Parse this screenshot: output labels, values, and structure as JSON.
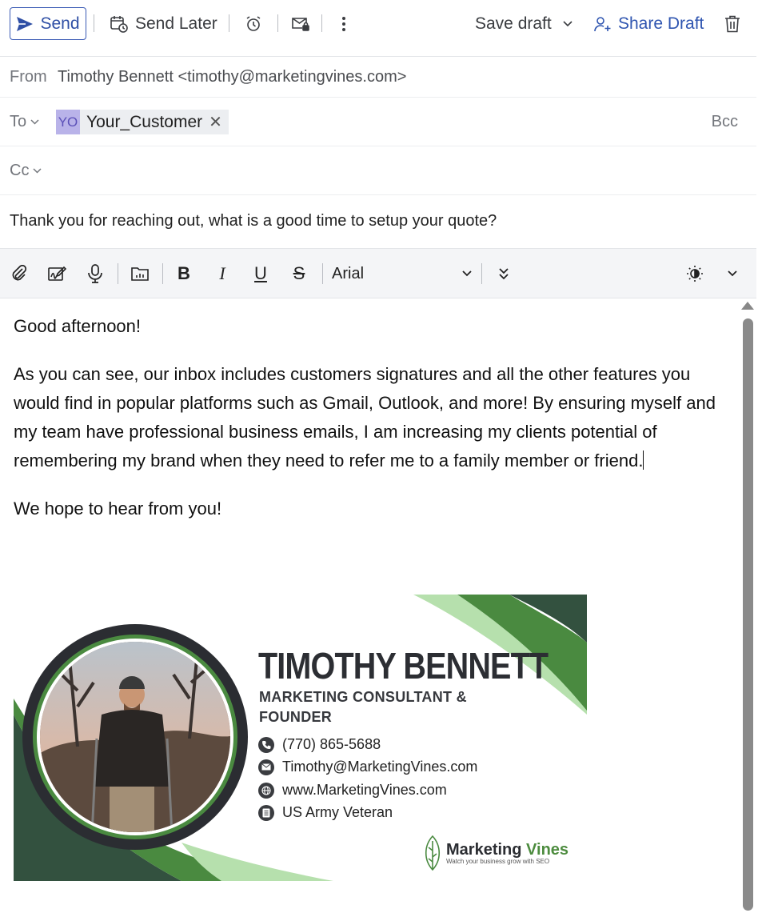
{
  "toolbar": {
    "send": "Send",
    "send_later": "Send Later",
    "save_draft": "Save draft",
    "share_draft": "Share Draft"
  },
  "header": {
    "from_label": "From",
    "from_value": "Timothy Bennett <timothy@marketingvines.com>",
    "to_label": "To",
    "to_chip_initials": "YO",
    "to_chip_name": "Your_Customer",
    "bcc_label": "Bcc",
    "cc_label": "Cc",
    "subject": "Thank you for reaching out, what is a good time to setup your quote?"
  },
  "format": {
    "font": "Arial",
    "bold": "B",
    "italic": "I",
    "underline": "U",
    "strike": "S"
  },
  "body": {
    "greeting": "Good afternoon!",
    "paragraph": "As you can see, our inbox includes customers signatures and all the other features you would find in popular platforms such as Gmail, Outlook, and more! By ensuring myself and my team have professional business emails, I am increasing my clients potential of remembering my brand when they need to refer me to a family member or friend.",
    "closing": "We hope to hear from you!"
  },
  "signature": {
    "name": "TIMOTHY BENNETT",
    "role": "MARKETING CONSULTANT & FOUNDER",
    "phone": "(770) 865-5688",
    "email": "Timothy@MarketingVines.com",
    "website": "www.MarketingVines.com",
    "note": "US Army Veteran",
    "brand_first": "Marketing ",
    "brand_second": "Vines",
    "brand_tagline": "Watch your business grow with SEO",
    "colors": {
      "dark_green": "#33513f",
      "green": "#4a8a40",
      "light_green": "#b6e0ad",
      "ring": "#2b2d32"
    }
  },
  "colors": {
    "accent": "#2f4fa5",
    "toolbar_bg": "#f4f5f7"
  }
}
